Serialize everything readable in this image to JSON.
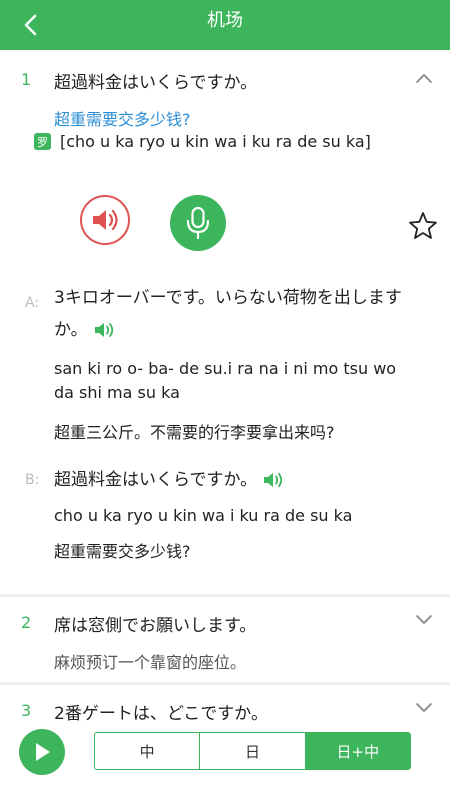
{
  "header": {
    "title": "机场"
  },
  "item1": {
    "number": "1",
    "japanese": "超過料金はいくらですか。",
    "chinese": "超重需要交多少钱?",
    "romaji_badge": "罗",
    "romaji": "[cho u ka ryo u kin wa i ku ra de su ka]",
    "dialogue": [
      {
        "speaker": "A:",
        "japanese": "3キロオーバーです。いらない荷物を出しますか。",
        "romaji": "san ki ro o- ba- de su.i ra na i ni mo tsu wo da shi ma su ka",
        "chinese": "超重三公斤。不需要的行李要拿出来吗?"
      },
      {
        "speaker": "B:",
        "japanese": "超過料金はいくらですか。",
        "romaji": "cho u ka ryo u kin wa i ku ra de su ka",
        "chinese": "超重需要交多少钱?"
      }
    ]
  },
  "item2": {
    "number": "2",
    "japanese": "席は窓側でお願いします。",
    "chinese": "麻烦预订一个靠窗的座位。"
  },
  "item3": {
    "number": "3",
    "japanese": "2番ゲートは、どこですか。"
  },
  "footer": {
    "modes": [
      "中",
      "日",
      "日+中"
    ],
    "active_mode": "日+中"
  },
  "colors": {
    "accent": "#3cb55c",
    "link": "#2c8fd6",
    "speaker_red": "#e05252"
  },
  "icons": {
    "back": "back-arrow-icon",
    "collapse": "chevron-up-icon",
    "expand": "chevron-down-icon",
    "play_audio": "speaker-icon",
    "record": "microphone-icon",
    "favorite": "star-outline-icon",
    "play": "play-icon"
  }
}
